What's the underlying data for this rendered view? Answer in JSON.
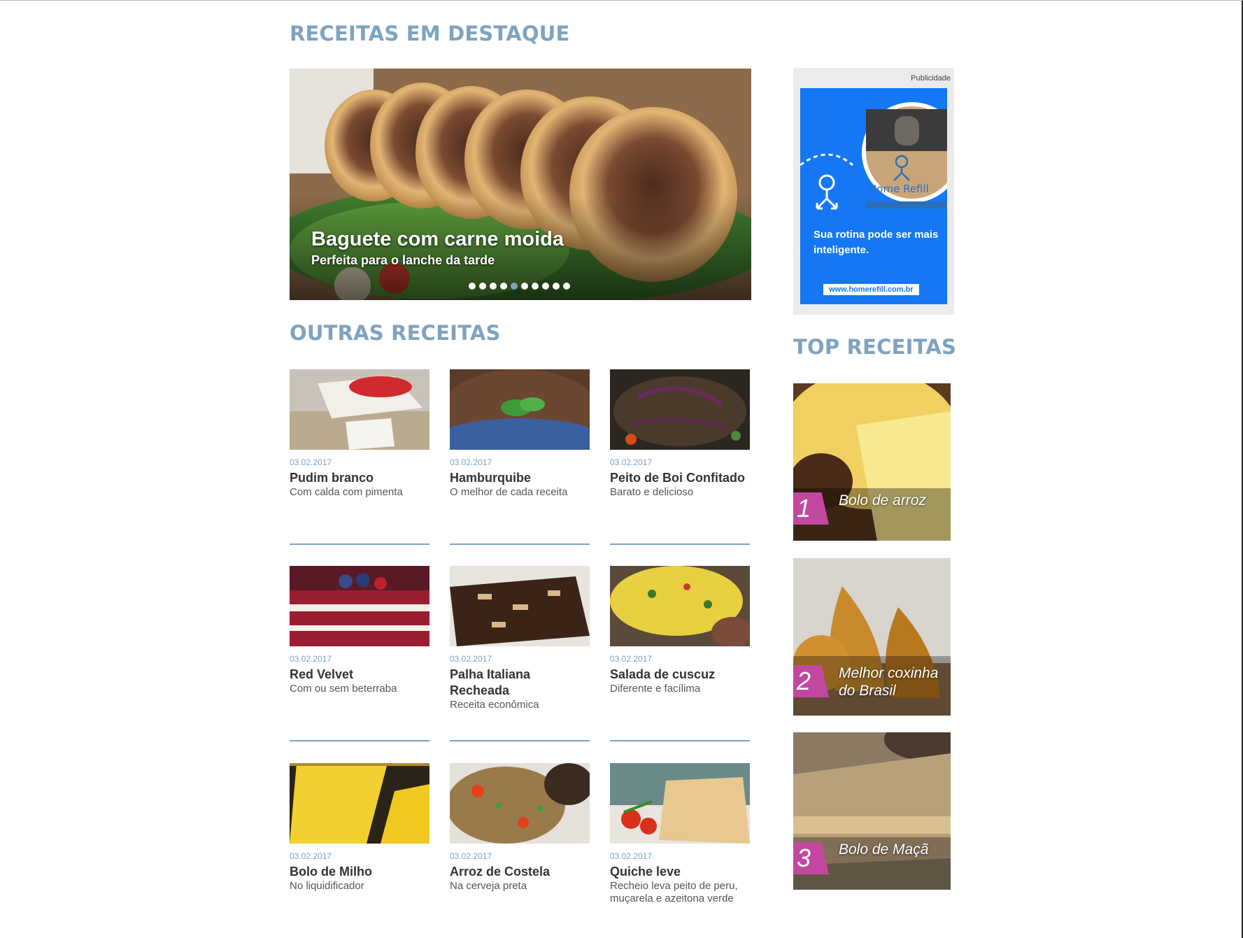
{
  "sections": {
    "featured": "RECEITAS EM DESTAQUE",
    "other": "OUTRAS RECEITAS",
    "top": "TOP RECEITAS"
  },
  "hero": {
    "title": "Baguete com carne moida",
    "subtitle": "Perfeita para o lanche da tarde",
    "slide_count": 10,
    "active_slide": 5
  },
  "ad": {
    "label": "Publicidade",
    "brand": "Home Refill",
    "headline": "Sua rotina pode ser mais inteligente.",
    "url": "www.homerefill.com.br",
    "background": "#1478f4"
  },
  "recipes": [
    {
      "date": "03.02.2017",
      "name": "Pudim branco",
      "desc": "Com calda com pimenta"
    },
    {
      "date": "03.02.2017",
      "name": "Hamburquibe",
      "desc": "O melhor de cada receita"
    },
    {
      "date": "03.02.2017",
      "name": "Peito de Boi Confitado",
      "desc": "Barato e delicioso"
    },
    {
      "date": "03.02.2017",
      "name": "Red Velvet",
      "desc": "Com ou sem beterraba"
    },
    {
      "date": "03.02.2017",
      "name": "Palha Italiana Recheada",
      "desc": "Receita econômica"
    },
    {
      "date": "03.02.2017",
      "name": "Salada de cuscuz",
      "desc": "Diferente e facílima"
    },
    {
      "date": "03.02.2017",
      "name": "Bolo de Milho",
      "desc": "No liquidificador"
    },
    {
      "date": "03.02.2017",
      "name": "Arroz de Costela",
      "desc": "Na cerveja preta"
    },
    {
      "date": "03.02.2017",
      "name": "Quiche leve",
      "desc": "Recheio leva peito de peru, muçarela e azeitona verde"
    }
  ],
  "top_recipes": [
    {
      "rank": "1",
      "name": "Bolo de arroz"
    },
    {
      "rank": "2",
      "name": "Melhor coxinha do Brasil"
    },
    {
      "rank": "3",
      "name": "Bolo de Maçã"
    }
  ],
  "colors": {
    "accent": "#7ea3c0",
    "rank_badge": "#c2489f",
    "text": "#333333"
  }
}
